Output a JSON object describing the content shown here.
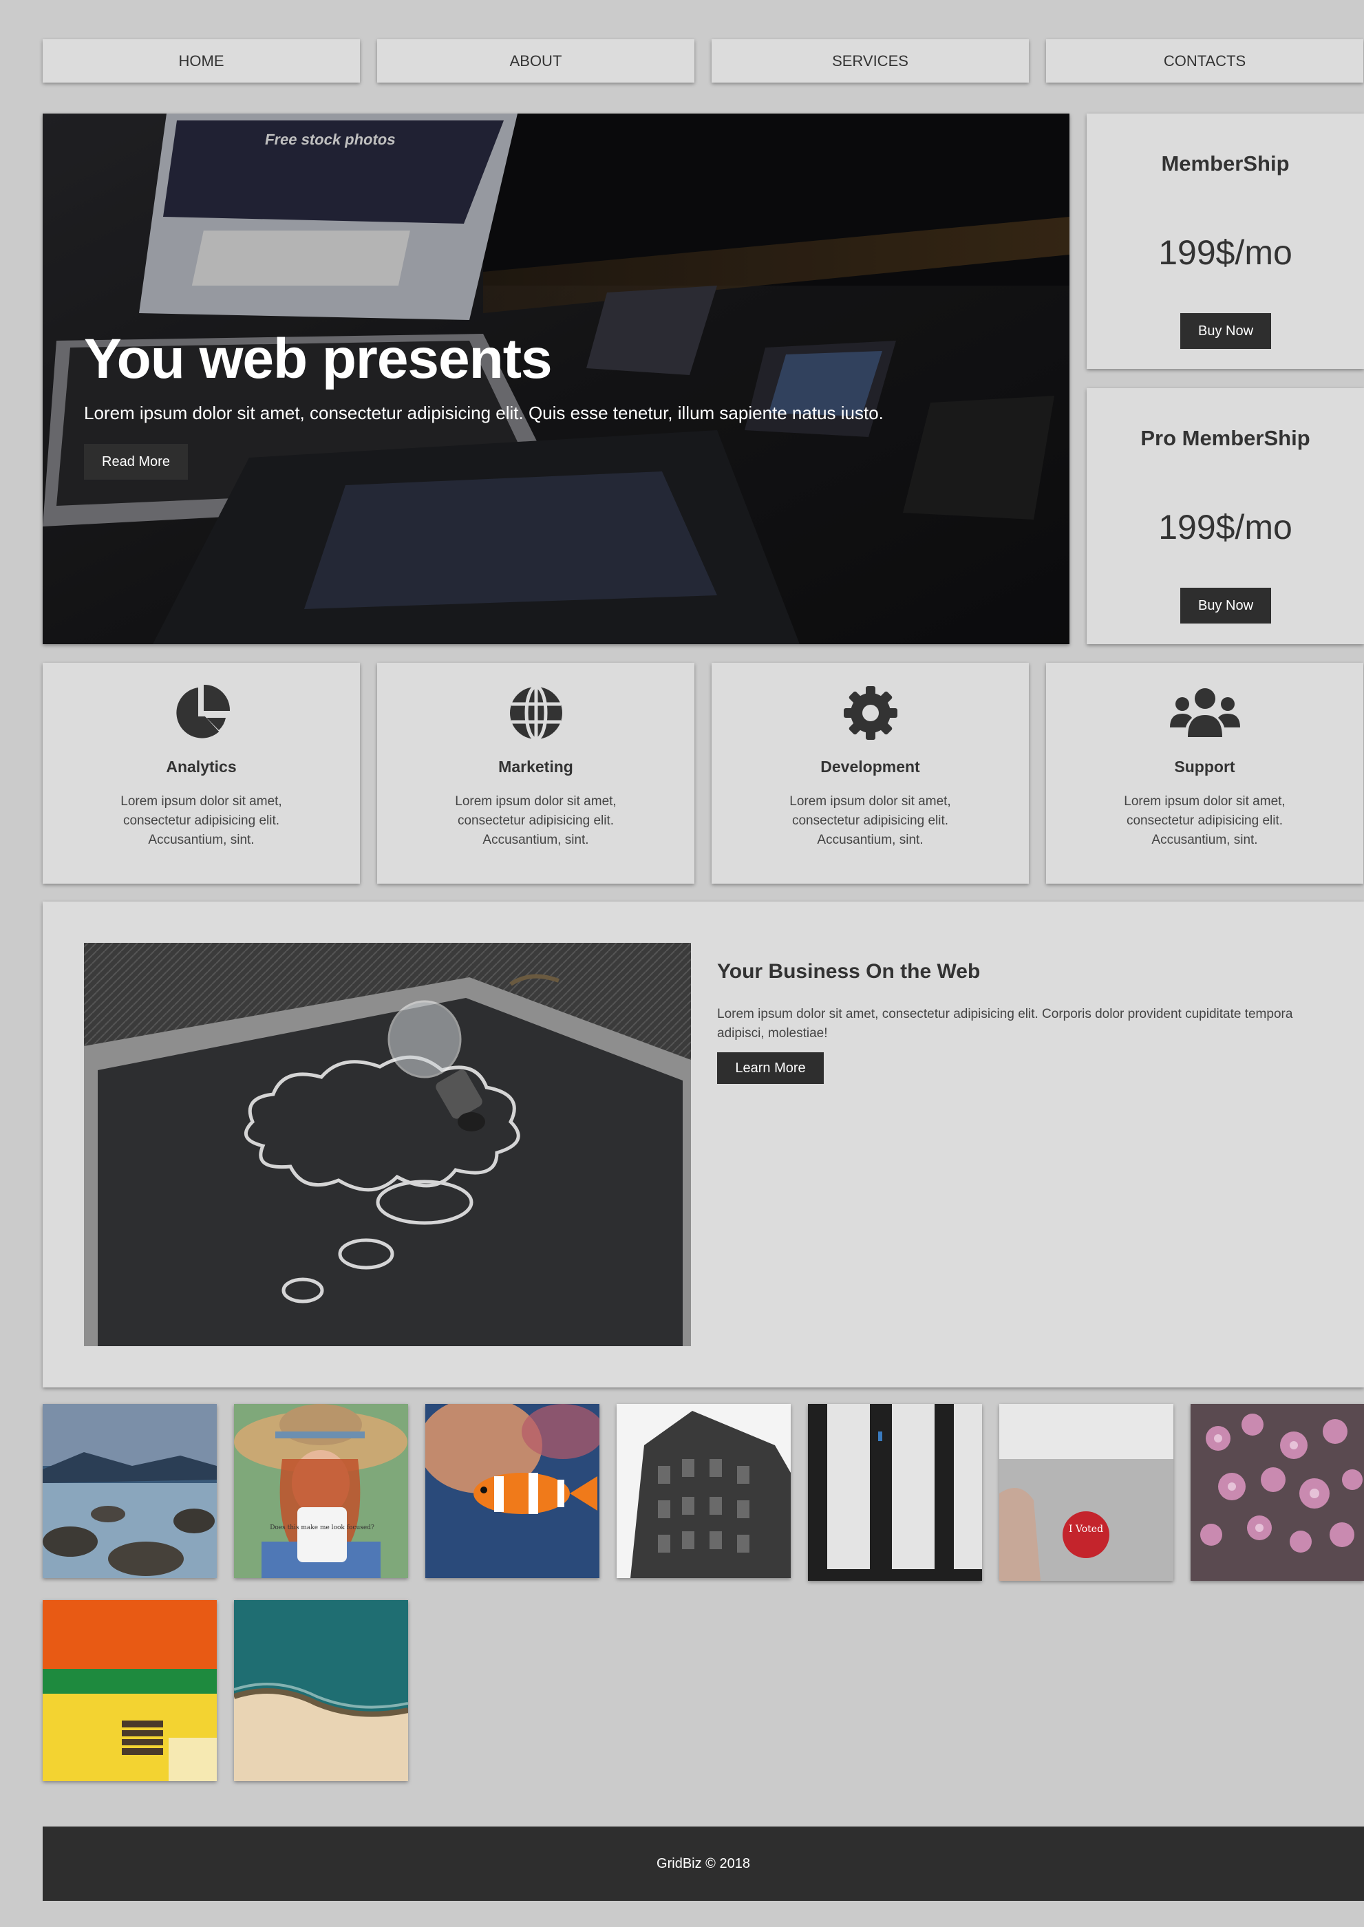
{
  "nav": {
    "items": [
      {
        "label": "HOME"
      },
      {
        "label": "ABOUT"
      },
      {
        "label": "SERVICES"
      },
      {
        "label": "CONTACTS"
      }
    ]
  },
  "hero": {
    "title": "You web presents",
    "text": "Lorem ipsum dolor sit amet, consectetur adipisicing elit. Quis esse tenetur, illum sapiente natus iusto.",
    "button": "Read More",
    "screen_heading": "Free stock photos"
  },
  "pricing": [
    {
      "title": "MemberShip",
      "price": "199$/mo",
      "button": "Buy Now"
    },
    {
      "title": "Pro MemberShip",
      "price": "199$/mo",
      "button": "Buy Now"
    }
  ],
  "features": [
    {
      "icon": "pie-chart-icon",
      "title": "Analytics",
      "text": "Lorem ipsum dolor sit amet, consectetur adipisicing elit. Accusantium, sint."
    },
    {
      "icon": "globe-icon",
      "title": "Marketing",
      "text": "Lorem ipsum dolor sit amet, consectetur adipisicing elit. Accusantium, sint."
    },
    {
      "icon": "gear-icon",
      "title": "Development",
      "text": "Lorem ipsum dolor sit amet, consectetur adipisicing elit. Accusantium, sint."
    },
    {
      "icon": "users-icon",
      "title": "Support",
      "text": "Lorem ipsum dolor sit amet, consectetur adipisicing elit. Accusantium, sint."
    }
  ],
  "business": {
    "title": "Your Business On the Web",
    "text": "Lorem ipsum dolor sit amet, consectetur adipisicing elit. Corporis dolor provident cupiditate tempora adipisci, molestiae!",
    "button": "Learn More"
  },
  "gallery": {
    "images": [
      {
        "subject": "rocky-sea-shore"
      },
      {
        "subject": "woman-with-hat-and-mug",
        "mug_text": "Does this make me look focused?"
      },
      {
        "subject": "clownfish"
      },
      {
        "subject": "old-building"
      },
      {
        "subject": "aerial-road-panels"
      },
      {
        "subject": "i-voted-sticker",
        "sticker_text": "I Voted"
      },
      {
        "subject": "pink-flowers"
      },
      {
        "subject": "colorful-wall-window"
      },
      {
        "subject": "aerial-beach"
      }
    ]
  },
  "footer": {
    "text": "GridBiz © 2018"
  },
  "colors": {
    "page_bg": "#cbcbcb",
    "card_bg": "#dcdcdc",
    "dark": "#2e2e2e",
    "text": "#333333"
  }
}
